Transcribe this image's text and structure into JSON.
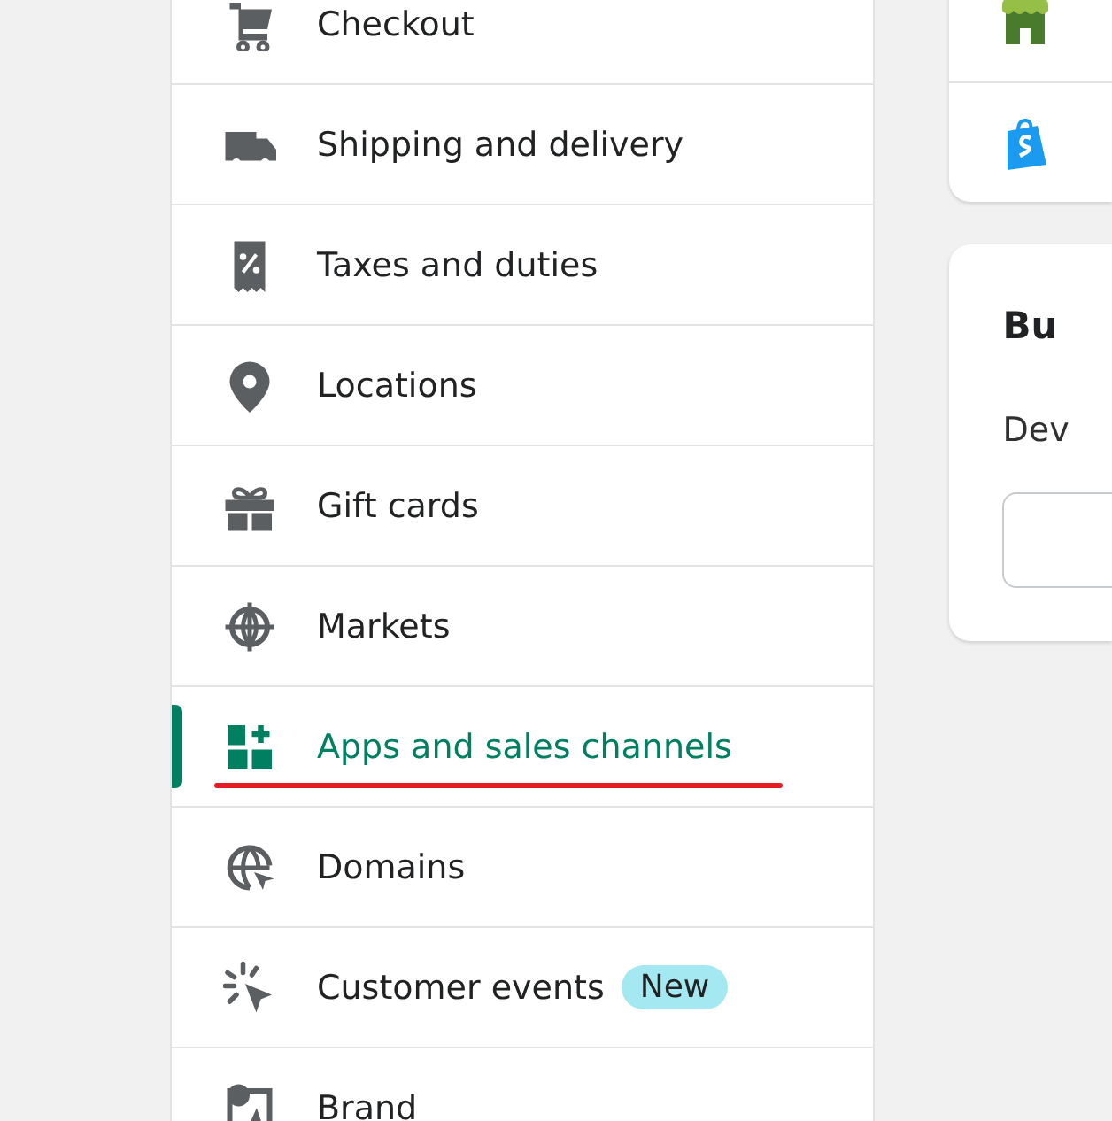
{
  "settings_nav": {
    "items": [
      {
        "label": "Checkout",
        "selected": false
      },
      {
        "label": "Shipping and delivery",
        "selected": false
      },
      {
        "label": "Taxes and duties",
        "selected": false
      },
      {
        "label": "Locations",
        "selected": false
      },
      {
        "label": "Gift cards",
        "selected": false
      },
      {
        "label": "Markets",
        "selected": false
      },
      {
        "label": "Apps and sales channels",
        "selected": true,
        "underlined": true
      },
      {
        "label": "Domains",
        "selected": false
      },
      {
        "label": "Customer events",
        "selected": false,
        "badge": "New"
      },
      {
        "label": "Brand",
        "selected": false
      }
    ]
  },
  "right_panel": {
    "heading": "Bu",
    "text": "Dev"
  }
}
